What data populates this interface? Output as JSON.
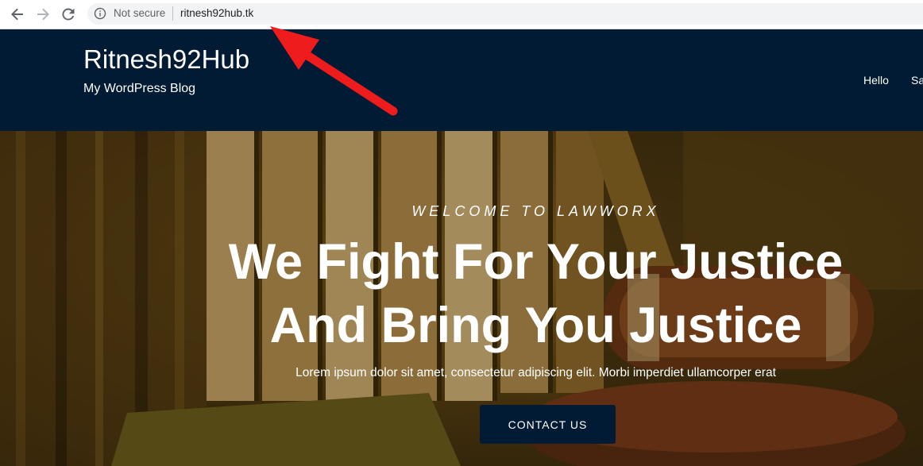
{
  "browser": {
    "security_label": "Not secure",
    "url": "ritnesh92hub.tk",
    "icons": [
      "back-arrow-icon",
      "forward-arrow-icon",
      "reload-icon",
      "info-icon"
    ]
  },
  "site": {
    "title": "Ritnesh92Hub",
    "tagline": "My WordPress Blog",
    "nav": [
      "Hello",
      "Sa"
    ]
  },
  "hero": {
    "welcome": "WELCOME TO LAWWORX",
    "headline_line1": "We Fight For Your Justice",
    "headline_line2": "And Bring You Justice",
    "subtext": "Lorem ipsum dolor sit amet, consectetur adipiscing elit. Morbi imperdiet ullamcorper erat",
    "cta_label": "CONTACT US"
  },
  "colors": {
    "header_bg": "#001b33",
    "button_bg": "#001b33",
    "annotation_arrow": "#ee1c1c"
  }
}
